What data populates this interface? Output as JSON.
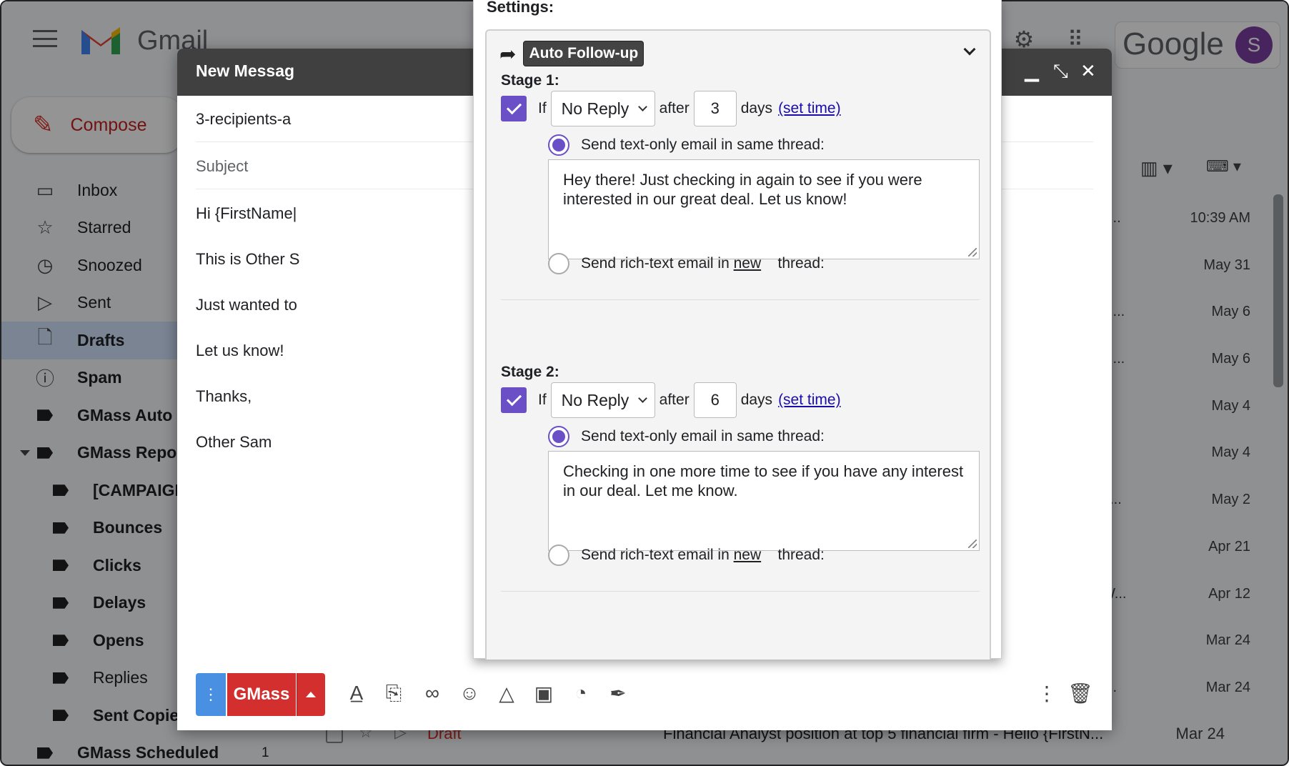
{
  "gmail": {
    "logo_text": "Gmail",
    "google_text": "Google",
    "avatar_letter": "S",
    "compose_label": "Compose"
  },
  "nav": [
    {
      "label": "Inbox",
      "icon": "inbox-icon"
    },
    {
      "label": "Starred",
      "icon": "star-icon"
    },
    {
      "label": "Snoozed",
      "icon": "clock-icon"
    },
    {
      "label": "Sent",
      "icon": "send-icon"
    },
    {
      "label": "Drafts",
      "icon": "draft-icon"
    },
    {
      "label": "Spam",
      "icon": "spam-icon"
    },
    {
      "label": "GMass Auto F",
      "icon": "label-icon"
    },
    {
      "label": "GMass Repor",
      "icon": "label-icon"
    },
    {
      "label": "[CAMPAIGN",
      "icon": "label-icon"
    },
    {
      "label": "Bounces",
      "icon": "label-icon"
    },
    {
      "label": "Clicks",
      "icon": "label-icon"
    },
    {
      "label": "Delays",
      "icon": "label-icon"
    },
    {
      "label": "Opens",
      "icon": "label-icon"
    },
    {
      "label": "Replies",
      "icon": "label-icon"
    },
    {
      "label": "Sent Copies",
      "icon": "label-icon"
    },
    {
      "label": "GMass Scheduled",
      "icon": "label-icon",
      "count": "1"
    }
  ],
  "mail_list": [
    {
      "snippet": "F...",
      "date": "10:39 AM"
    },
    {
      "snippet": "",
      "date": "May 31"
    },
    {
      "snippet": "c ...",
      "date": "May 6"
    },
    {
      "snippet": "c ...",
      "date": "May 6"
    },
    {
      "snippet": "",
      "date": "May 4"
    },
    {
      "snippet": "",
      "date": "May 4"
    },
    {
      "snippet": "e...",
      "date": "May 2"
    },
    {
      "snippet": "",
      "date": "Apr 21"
    },
    {
      "snippet": "W...",
      "date": "Apr 12"
    },
    {
      "snippet": "",
      "date": "Mar 24"
    },
    {
      "snippet": "i...",
      "date": "Mar 24"
    }
  ],
  "draft_row": {
    "label": "Draft",
    "subject": "Financial Analyst position at top 5 financial firm - Hello {FirstN...",
    "date": "Mar 24"
  },
  "compose_window": {
    "title": "New Messag",
    "to": "3-recipients-a",
    "subject_placeholder": "Subject",
    "body_lines": [
      "Hi {FirstName|",
      "This is Other S",
      "Just wanted to",
      "Let us know!",
      "Thanks,",
      "Other Sam"
    ],
    "send_label": "GMass"
  },
  "settings": {
    "title": "Settings:",
    "section_label": "Auto Follow-up",
    "stages": [
      {
        "label": "Stage 1:",
        "if_label": "If",
        "condition": "No Reply",
        "after_label": "after",
        "days": "3",
        "days_label": "days",
        "set_time": "(set time)",
        "option_text_only": "Send text-only email in same thread:",
        "message": "Hey there! Just checking in again to see if you were interested in our great deal. Let us know!",
        "option_rich_prefix": "Send rich-text email in",
        "option_rich_new": "new",
        "option_rich_suffix": "thread:"
      },
      {
        "label": "Stage 2:",
        "if_label": "If",
        "condition": "No Reply",
        "after_label": "after",
        "days": "6",
        "days_label": "days",
        "set_time": "(set time)",
        "option_text_only": "Send text-only email in same thread:",
        "message": "Checking in one more time to see if you have any interest in our deal. Let me know.",
        "option_rich_prefix": "Send rich-text email in",
        "option_rich_new": "new",
        "option_rich_suffix": "thread:"
      }
    ]
  },
  "colors": {
    "accent": "#6a4fc6",
    "gmass_red": "#d32f2f",
    "options_blue": "#4a90e2"
  }
}
